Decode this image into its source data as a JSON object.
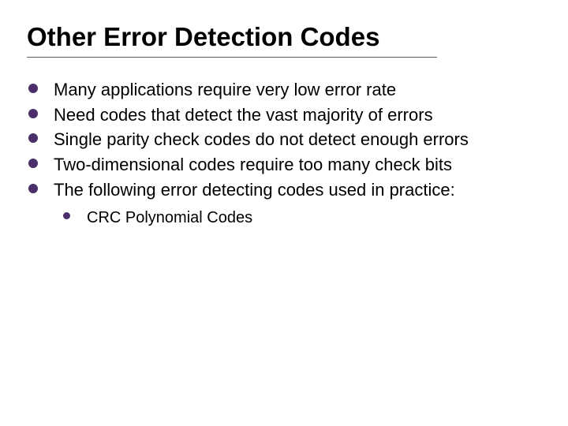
{
  "title": "Other Error Detection Codes",
  "bullets": [
    {
      "text": "Many applications require very low error rate"
    },
    {
      "text": "Need codes that detect the vast majority of errors"
    },
    {
      "text": "Single parity check codes do not detect enough errors"
    },
    {
      "text": "Two-dimensional codes require too many check bits"
    },
    {
      "text": "The following error detecting codes used in practice:"
    }
  ],
  "sub_bullets": [
    {
      "text": "CRC Polynomial Codes"
    }
  ]
}
